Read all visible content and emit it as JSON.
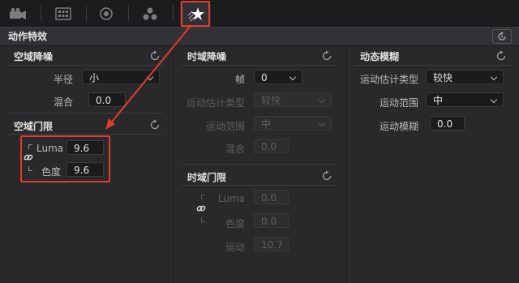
{
  "toolbar": {
    "buttons": [
      {
        "icon": "camera-icon"
      },
      {
        "icon": "grid-icon"
      },
      {
        "icon": "target-icon"
      },
      {
        "icon": "dots-cluster-icon"
      },
      {
        "icon": "star-fx-icon",
        "active": true
      }
    ]
  },
  "panel_title": "动作特效",
  "spatial_nr": {
    "title": "空域降噪",
    "radius_label": "半径",
    "radius_value": "小",
    "blend_label": "混合",
    "blend_value": "0.0"
  },
  "spatial_threshold": {
    "title": "空域门限",
    "luma_label": "Luma",
    "luma_value": "9.6",
    "chroma_label": "色度",
    "chroma_value": "9.6"
  },
  "temporal_nr": {
    "title": "时域降噪",
    "frames_label": "帧",
    "frames_value": "0",
    "motion_est_label": "运动估计类型",
    "motion_est_value": "较快",
    "motion_range_label": "运动范围",
    "motion_range_value": "中",
    "blend_label": "混合",
    "blend_value": "0.0"
  },
  "temporal_threshold": {
    "title": "时域门限",
    "luma_label": "Luma",
    "luma_value": "0.0",
    "chroma_label": "色度",
    "chroma_value": "0.0",
    "motion_label": "运动",
    "motion_value": "10.7"
  },
  "motion_blur": {
    "title": "动态模糊",
    "motion_est_label": "运动估计类型",
    "motion_est_value": "较快",
    "motion_range_label": "运动范围",
    "motion_range_value": "中",
    "blur_label": "运动模糊",
    "blur_value": "0.0"
  },
  "colors": {
    "highlight": "#e23b2a",
    "background": "#29292c"
  }
}
